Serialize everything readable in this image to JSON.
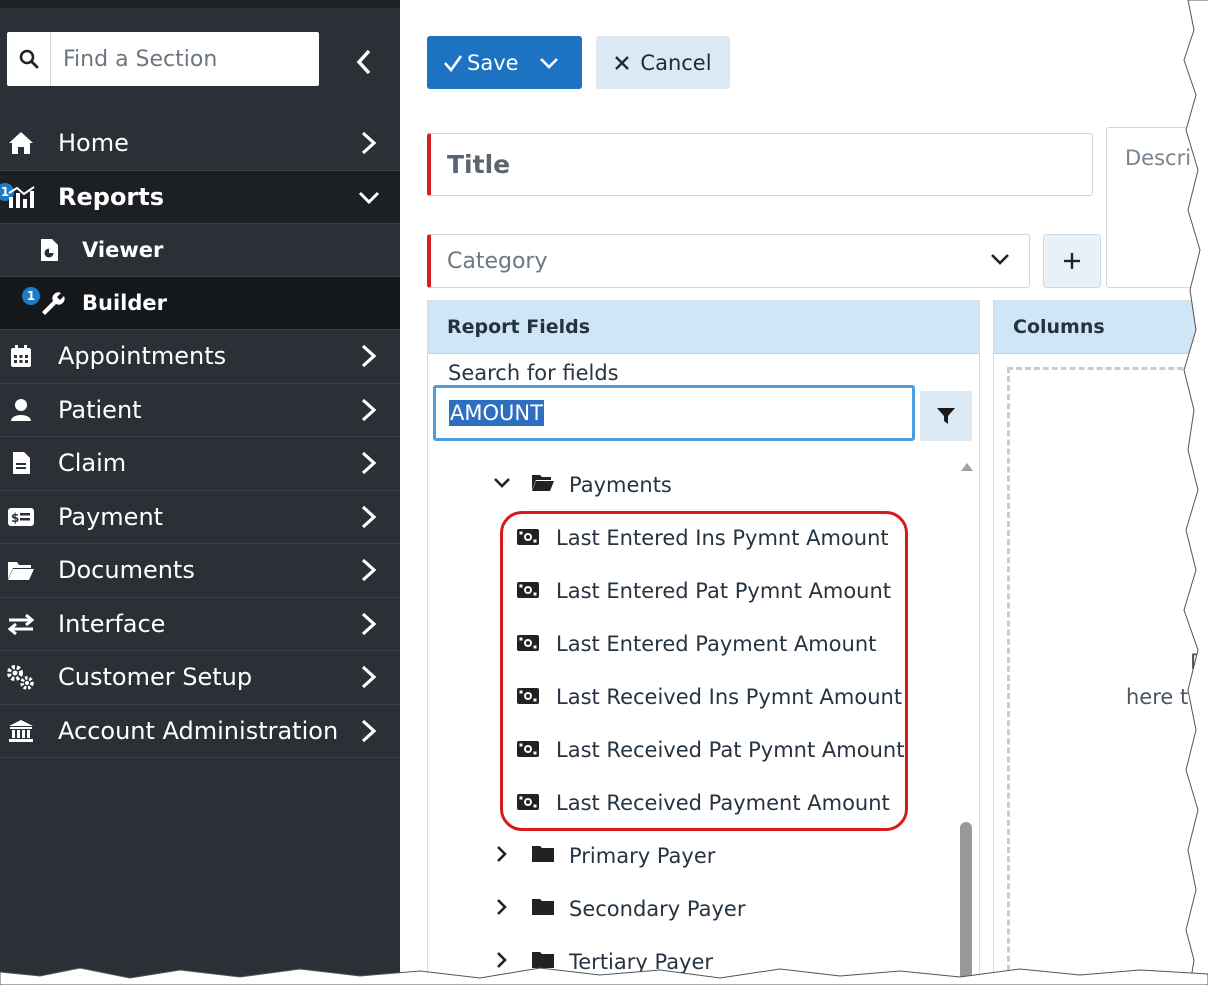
{
  "sidebar": {
    "search_placeholder": "Find a Section",
    "items": [
      {
        "label": "Home",
        "icon": "home-icon"
      },
      {
        "label": "Reports",
        "icon": "reports-icon",
        "badge": "1"
      },
      {
        "label": "Viewer",
        "icon": "file-chart-icon"
      },
      {
        "label": "Builder",
        "icon": "wrench-icon",
        "badge": "1"
      },
      {
        "label": "Appointments",
        "icon": "calendar-icon"
      },
      {
        "label": "Patient",
        "icon": "user-icon"
      },
      {
        "label": "Claim",
        "icon": "document-icon"
      },
      {
        "label": "Payment",
        "icon": "money-icon"
      },
      {
        "label": "Documents",
        "icon": "folder-open-icon"
      },
      {
        "label": "Interface",
        "icon": "exchange-icon"
      },
      {
        "label": "Customer Setup",
        "icon": "gears-icon"
      },
      {
        "label": "Account Administration",
        "icon": "bank-icon"
      }
    ]
  },
  "toolbar": {
    "save_label": "Save",
    "cancel_label": "Cancel"
  },
  "form": {
    "title_placeholder": "Title",
    "category_placeholder": "Category",
    "description_placeholder": "Descri"
  },
  "report_fields": {
    "header": "Report Fields",
    "search_label": "Search for fields",
    "search_value": "AMOUNT",
    "tree": [
      {
        "label": "Payments",
        "expanded": true
      },
      {
        "label": "Last Entered Ins Pymnt Amount"
      },
      {
        "label": "Last Entered Pat Pymnt Amount"
      },
      {
        "label": "Last Entered Payment Amount"
      },
      {
        "label": "Last Received Ins Pymnt Amount"
      },
      {
        "label": "Last Received Pat Pymnt Amount"
      },
      {
        "label": "Last Received Payment Amount"
      },
      {
        "label": "Primary Payer",
        "expanded": false
      },
      {
        "label": "Secondary Payer",
        "expanded": false
      },
      {
        "label": "Tertiary Payer",
        "expanded": false
      }
    ]
  },
  "columns": {
    "header": "Columns",
    "drop_text_1": "Dra",
    "drop_text_2": "here to"
  },
  "colors": {
    "sidebar_bg": "#2b3036",
    "accent": "#1b73c2",
    "highlight": "#d81a1a",
    "required": "#d61f1f"
  }
}
